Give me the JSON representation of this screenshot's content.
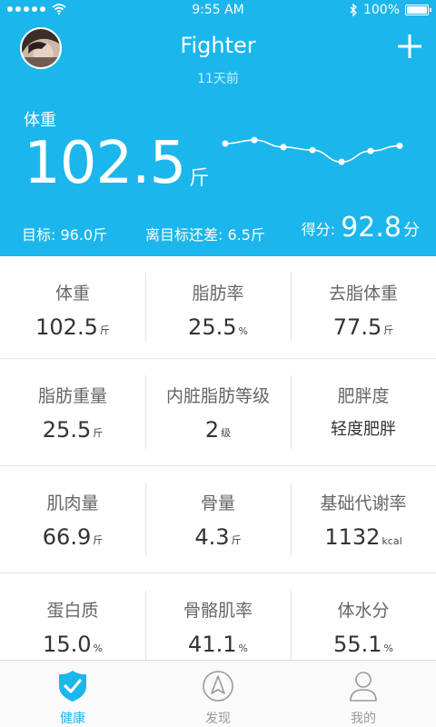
{
  "status_bar": {
    "time": "9:55 AM",
    "battery": "100%",
    "battery_level": 1.0,
    "signal_dots": 5
  },
  "header": {
    "username": "Fighter",
    "updated": "11天前",
    "weight_label": "体重",
    "weight_value": "102.5",
    "weight_unit": "斤",
    "goal": "目标:  96.0斤",
    "diff": "离目标还差: 6.5斤",
    "score_label": "得分:",
    "score_value": "92.8",
    "score_unit": "分",
    "icons": {
      "add": "plus-icon",
      "avatar": "avatar",
      "wifi": "wifi-icon",
      "bluetooth": "bluetooth-icon"
    }
  },
  "trend": {
    "type": "line",
    "values": [
      0.5,
      0.58,
      0.42,
      0.35,
      0.08,
      0.33,
      0.45
    ],
    "color": "#ffffff"
  },
  "metrics": [
    [
      {
        "label": "体重",
        "value": "102.5",
        "unit": "斤"
      },
      {
        "label": "脂肪率",
        "value": "25.5",
        "unit": "%"
      },
      {
        "label": "去脂体重",
        "value": "77.5",
        "unit": "斤"
      }
    ],
    [
      {
        "label": "脂肪重量",
        "value": "25.5",
        "unit": "斤"
      },
      {
        "label": "内脏脂肪等级",
        "value": "2",
        "unit": "级"
      },
      {
        "label": "肥胖度",
        "text": "轻度肥胖"
      }
    ],
    [
      {
        "label": "肌肉量",
        "value": "66.9",
        "unit": "斤"
      },
      {
        "label": "骨量",
        "value": "4.3",
        "unit": "斤"
      },
      {
        "label": "基础代谢率",
        "value": "1132",
        "unit": "kcal"
      }
    ],
    [
      {
        "label": "蛋白质",
        "value": "15.0",
        "unit": "%"
      },
      {
        "label": "骨骼肌率",
        "value": "41.1",
        "unit": "%"
      },
      {
        "label": "体水分",
        "value": "55.1",
        "unit": "%"
      }
    ]
  ],
  "tabs": [
    {
      "label": "健康",
      "icon": "shield-check-icon",
      "active": true
    },
    {
      "label": "发现",
      "icon": "compass-icon",
      "active": false
    },
    {
      "label": "我的",
      "icon": "user-icon",
      "active": false
    }
  ],
  "colors": {
    "primary": "#1bb6ec",
    "inactive": "#9a9a9a"
  }
}
